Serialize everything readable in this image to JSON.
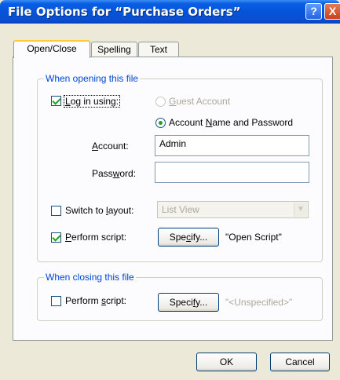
{
  "window": {
    "title": "File Options for “Purchase Orders”",
    "help_icon_text": "?",
    "close_icon_text": "X"
  },
  "tabs": [
    {
      "label": "Open/Close",
      "active": true
    },
    {
      "label": "Spelling",
      "active": false
    },
    {
      "label": "Text",
      "active": false
    }
  ],
  "opening": {
    "group_title": "When opening this file",
    "login": {
      "label_pre": "",
      "accel": "L",
      "label_post": "og in using:",
      "checked": true
    },
    "guest": {
      "label_pre": "",
      "accel": "G",
      "label_post": "uest Account",
      "selected": false,
      "disabled": true
    },
    "account_pw": {
      "label_pre": "Account ",
      "accel": "N",
      "label_post": "ame and Password",
      "selected": true
    },
    "account": {
      "label_pre": "",
      "accel": "A",
      "label_post": "ccount:",
      "value": "Admin"
    },
    "password": {
      "label_pre": "Pass",
      "accel": "w",
      "label_post": "ord:",
      "value": ""
    },
    "switch_layout": {
      "label_pre": "Switch to ",
      "accel": "l",
      "label_post": "ayout:",
      "checked": false,
      "value": "List View"
    },
    "perform_script": {
      "label_pre": "",
      "accel": "P",
      "label_post": "erform script:",
      "checked": true
    },
    "specify_button": {
      "label_pre": "Spe",
      "accel": "c",
      "label_post": "ify..."
    },
    "script_name": "\"Open Script\""
  },
  "closing": {
    "group_title": "When closing this file",
    "perform_script": {
      "label_pre": "Perform ",
      "accel": "s",
      "label_post": "cript:",
      "checked": false
    },
    "specify_button": {
      "label_pre": "Speci",
      "accel": "f",
      "label_post": "y..."
    },
    "script_name": "\"<Unspecified>\""
  },
  "buttons": {
    "ok": "OK",
    "cancel": "Cancel"
  },
  "colors": {
    "titlebar": "#0553D9",
    "group_title": "#0046D5",
    "check_mark": "#21A121",
    "tab_highlight": "#FFC83C"
  }
}
